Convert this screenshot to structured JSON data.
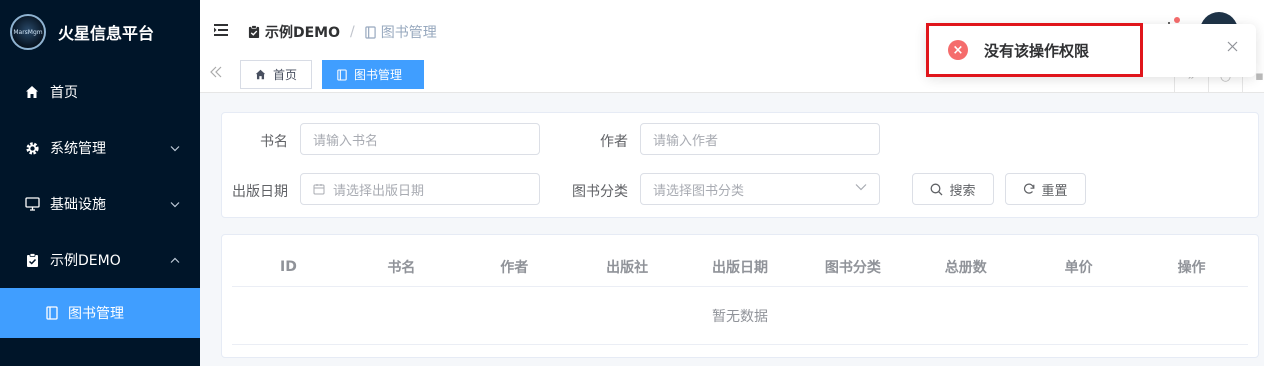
{
  "brand": {
    "title": "火星信息平台",
    "logo_icon": "mars-logo-icon"
  },
  "sidebar": {
    "items": [
      {
        "label": "首页",
        "icon": "home-icon"
      },
      {
        "label": "系统管理",
        "icon": "gear-icon",
        "expandable": true
      },
      {
        "label": "基础设施",
        "icon": "monitor-icon",
        "expandable": true
      },
      {
        "label": "示例DEMO",
        "icon": "clipboard-icon",
        "expandable": true,
        "expanded": true
      }
    ],
    "submenu": [
      {
        "label": "图书管理",
        "icon": "book-icon",
        "active": true
      }
    ],
    "colors": {
      "background": "#001529",
      "active": "#409eff"
    }
  },
  "header": {
    "breadcrumb": [
      {
        "label": "示例DEMO"
      },
      {
        "label": "图书管理"
      }
    ],
    "separator": "/"
  },
  "tabs": [
    {
      "label": "首页",
      "icon": "home-icon",
      "active": false
    },
    {
      "label": "图书管理",
      "icon": "book-icon",
      "active": true
    }
  ],
  "search": {
    "fields": [
      {
        "label": "书名",
        "placeholder": "请输入书名"
      },
      {
        "label": "作者",
        "placeholder": "请输入作者"
      },
      {
        "label": "出版日期",
        "placeholder": "请选择出版日期"
      },
      {
        "label": "图书分类",
        "placeholder": "请选择图书分类"
      }
    ],
    "search_button": "搜索",
    "reset_button": "重置"
  },
  "table": {
    "columns": [
      "ID",
      "书名",
      "作者",
      "出版社",
      "出版日期",
      "图书分类",
      "总册数",
      "单价",
      "操作"
    ],
    "rows": [],
    "empty_text": "暂无数据"
  },
  "toast": {
    "type": "error",
    "message": "没有该操作权限",
    "icon": "error-circle-icon",
    "highlight_color": "#e0151b"
  }
}
